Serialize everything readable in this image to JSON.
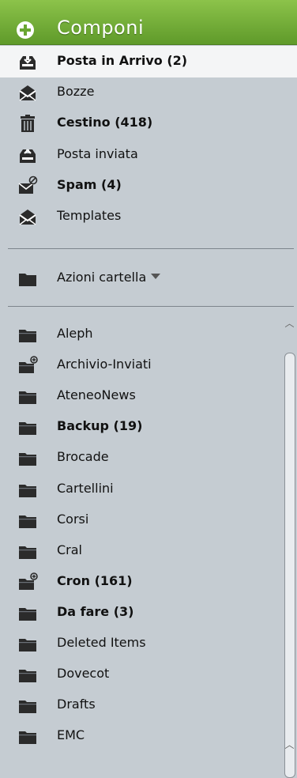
{
  "compose": {
    "label": "Componi"
  },
  "special_folders": [
    {
      "label": "Posta in Arrivo (2)",
      "icon": "inbox-icon",
      "bold": true
    },
    {
      "label": "Bozze",
      "icon": "drafts-icon",
      "bold": false
    },
    {
      "label": "Cestino (418)",
      "icon": "trash-icon",
      "bold": true
    },
    {
      "label": "Posta inviata",
      "icon": "sent-icon",
      "bold": false
    },
    {
      "label": "Spam (4)",
      "icon": "spam-icon",
      "bold": true
    },
    {
      "label": "Templates",
      "icon": "templates-icon",
      "bold": false
    }
  ],
  "folder_actions": {
    "label": "Azioni cartella",
    "icon": "folder-icon"
  },
  "folders": [
    {
      "label": "Aleph",
      "icon": "folder-icon",
      "bold": false
    },
    {
      "label": "Archivio-Inviati",
      "icon": "folder-subfolders-icon",
      "bold": false
    },
    {
      "label": "AteneoNews",
      "icon": "folder-icon",
      "bold": false
    },
    {
      "label": "Backup (19)",
      "icon": "folder-icon",
      "bold": true
    },
    {
      "label": "Brocade",
      "icon": "folder-icon",
      "bold": false
    },
    {
      "label": "Cartellini",
      "icon": "folder-icon",
      "bold": false
    },
    {
      "label": "Corsi",
      "icon": "folder-icon",
      "bold": false
    },
    {
      "label": "Cral",
      "icon": "folder-icon",
      "bold": false
    },
    {
      "label": "Cron (161)",
      "icon": "folder-subfolders-icon",
      "bold": true
    },
    {
      "label": "Da fare (3)",
      "icon": "folder-icon",
      "bold": true
    },
    {
      "label": "Deleted Items",
      "icon": "folder-icon",
      "bold": false
    },
    {
      "label": "Dovecot",
      "icon": "folder-icon",
      "bold": false
    },
    {
      "label": "Drafts",
      "icon": "folder-icon",
      "bold": false
    },
    {
      "label": "EMC",
      "icon": "folder-icon",
      "bold": false
    }
  ]
}
